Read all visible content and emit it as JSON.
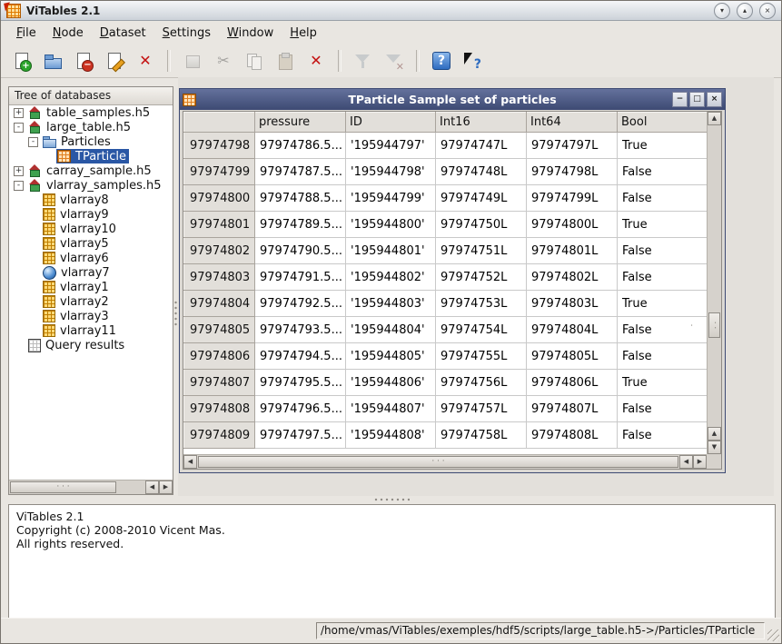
{
  "colors": {
    "selection": "#2a57a5",
    "child_titlebar_top": "#64719c",
    "child_titlebar_bottom": "#3d4a73",
    "titlebar_top": "#f5f6f8",
    "titlebar_bottom": "#ccd2d9"
  },
  "icons": {
    "up": "▲",
    "down": "▼",
    "left": "◀",
    "right": "▶"
  },
  "window": {
    "title": "ViTables 2.1",
    "controls": [
      {
        "name": "minimize",
        "glyph": "▾"
      },
      {
        "name": "maximize",
        "glyph": "▴"
      },
      {
        "name": "close",
        "glyph": "×"
      }
    ]
  },
  "menu": {
    "items": [
      "File",
      "Node",
      "Dataset",
      "Settings",
      "Window",
      "Help"
    ]
  },
  "toolbar": {
    "groups": [
      [
        {
          "name": "new-file",
          "enabled": true
        },
        {
          "name": "open-file",
          "enabled": true
        },
        {
          "name": "close-file",
          "enabled": true
        },
        {
          "name": "save-file-as",
          "enabled": true
        },
        {
          "name": "quit",
          "enabled": true
        }
      ],
      [
        {
          "name": "new-group",
          "enabled": false
        },
        {
          "name": "cut-node",
          "enabled": false
        },
        {
          "name": "copy-node",
          "enabled": false
        },
        {
          "name": "paste-node",
          "enabled": false
        },
        {
          "name": "delete-node",
          "enabled": true
        }
      ],
      [
        {
          "name": "new-query",
          "enabled": false
        },
        {
          "name": "delete-all-queries",
          "enabled": false
        }
      ],
      [
        {
          "name": "help",
          "enabled": true
        },
        {
          "name": "whats-this",
          "enabled": true
        }
      ]
    ]
  },
  "tree": {
    "header": "Tree of databases",
    "items": [
      {
        "label": "table_samples.h5",
        "depth": 0,
        "expander": "+",
        "icon": "db",
        "selected": false
      },
      {
        "label": "large_table.h5",
        "depth": 0,
        "expander": "-",
        "icon": "db",
        "selected": false
      },
      {
        "label": "Particles",
        "depth": 1,
        "expander": "-",
        "icon": "folder",
        "selected": false
      },
      {
        "label": "TParticle",
        "depth": 2,
        "expander": null,
        "icon": "table",
        "selected": true
      },
      {
        "label": "carray_sample.h5",
        "depth": 0,
        "expander": "+",
        "icon": "db",
        "selected": false
      },
      {
        "label": "vlarray_samples.h5",
        "depth": 0,
        "expander": "-",
        "icon": "db",
        "selected": false
      },
      {
        "label": "vlarray8",
        "depth": 1,
        "expander": null,
        "icon": "vlarray",
        "selected": false
      },
      {
        "label": "vlarray9",
        "depth": 1,
        "expander": null,
        "icon": "vlarray",
        "selected": false
      },
      {
        "label": "vlarray10",
        "depth": 1,
        "expander": null,
        "icon": "vlarray",
        "selected": false
      },
      {
        "label": "vlarray5",
        "depth": 1,
        "expander": null,
        "icon": "vlarray",
        "selected": false
      },
      {
        "label": "vlarray6",
        "depth": 1,
        "expander": null,
        "icon": "vlarray",
        "selected": false
      },
      {
        "label": "vlarray7",
        "depth": 1,
        "expander": null,
        "icon": "earth",
        "selected": false
      },
      {
        "label": "vlarray1",
        "depth": 1,
        "expander": null,
        "icon": "vlarray",
        "selected": false
      },
      {
        "label": "vlarray2",
        "depth": 1,
        "expander": null,
        "icon": "vlarray",
        "selected": false
      },
      {
        "label": "vlarray3",
        "depth": 1,
        "expander": null,
        "icon": "vlarray",
        "selected": false
      },
      {
        "label": "vlarray11",
        "depth": 1,
        "expander": null,
        "icon": "vlarray",
        "selected": false
      },
      {
        "label": "Query results",
        "depth": 0,
        "expander": null,
        "icon": "query",
        "selected": false
      }
    ]
  },
  "child_window": {
    "title": "TParticle Sample set of particles",
    "controls": [
      {
        "name": "minimize",
        "glyph": "−"
      },
      {
        "name": "maximize",
        "glyph": "□"
      },
      {
        "name": "close",
        "glyph": "×"
      }
    ],
    "table": {
      "columns": [
        "pressure",
        "ID",
        "Int16",
        "Int64",
        "Bool"
      ],
      "rows": [
        {
          "id": "97974798",
          "cells": [
            "97974786.5...",
            "'195944797'",
            "97974747L",
            "97974797L",
            "True"
          ]
        },
        {
          "id": "97974799",
          "cells": [
            "97974787.5...",
            "'195944798'",
            "97974748L",
            "97974798L",
            "False"
          ]
        },
        {
          "id": "97974800",
          "cells": [
            "97974788.5...",
            "'195944799'",
            "97974749L",
            "97974799L",
            "False"
          ]
        },
        {
          "id": "97974801",
          "cells": [
            "97974789.5...",
            "'195944800'",
            "97974750L",
            "97974800L",
            "True"
          ]
        },
        {
          "id": "97974802",
          "cells": [
            "97974790.5...",
            "'195944801'",
            "97974751L",
            "97974801L",
            "False"
          ]
        },
        {
          "id": "97974803",
          "cells": [
            "97974791.5...",
            "'195944802'",
            "97974752L",
            "97974802L",
            "False"
          ]
        },
        {
          "id": "97974804",
          "cells": [
            "97974792.5...",
            "'195944803'",
            "97974753L",
            "97974803L",
            "True"
          ]
        },
        {
          "id": "97974805",
          "cells": [
            "97974793.5...",
            "'195944804'",
            "97974754L",
            "97974804L",
            "False"
          ]
        },
        {
          "id": "97974806",
          "cells": [
            "97974794.5...",
            "'195944805'",
            "97974755L",
            "97974805L",
            "False"
          ]
        },
        {
          "id": "97974807",
          "cells": [
            "97974795.5...",
            "'195944806'",
            "97974756L",
            "97974806L",
            "True"
          ]
        },
        {
          "id": "97974808",
          "cells": [
            "97974796.5...",
            "'195944807'",
            "97974757L",
            "97974807L",
            "False"
          ]
        },
        {
          "id": "97974809",
          "cells": [
            "97974797.5...",
            "'195944808'",
            "97974758L",
            "97974808L",
            "False"
          ]
        }
      ]
    }
  },
  "log": {
    "lines": [
      "ViTables 2.1",
      "Copyright (c) 2008-2010 Vicent Mas.",
      "All rights reserved."
    ]
  },
  "statusbar": {
    "path": "/home/vmas/ViTables/exemples/hdf5/scripts/large_table.h5->/Particles/TParticle"
  }
}
